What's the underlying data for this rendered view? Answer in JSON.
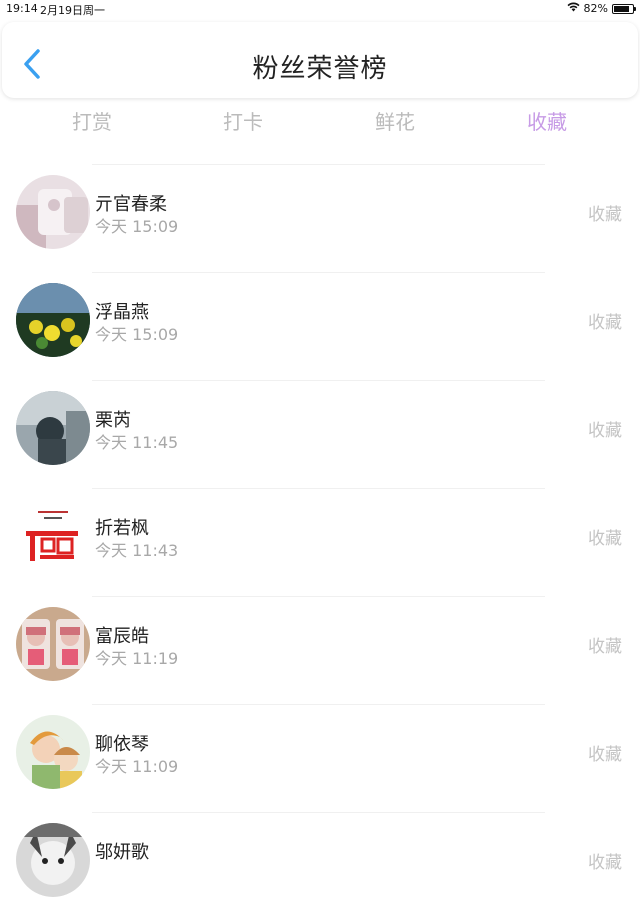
{
  "status_bar": {
    "time": "19:14",
    "date": "2月19日周一",
    "battery": "82%",
    "battery_level": 0.82
  },
  "header": {
    "title": "粉丝荣誉榜",
    "back_icon": "chevron-left-icon",
    "accent_color": "#3aa0f0"
  },
  "tabs": [
    {
      "label": "打赏",
      "active": false
    },
    {
      "label": "打卡",
      "active": false
    },
    {
      "label": "鲜花",
      "active": false
    },
    {
      "label": "收藏",
      "active": true
    }
  ],
  "colors": {
    "active_tab": "#c79be6",
    "inactive_tab": "#bbbbbb",
    "meta_text": "#a8a8a8"
  },
  "fans": [
    {
      "name": "亓官春柔",
      "time": "今天 15:09",
      "action": "收藏"
    },
    {
      "name": "浮晶燕",
      "time": "今天 15:09",
      "action": "收藏"
    },
    {
      "name": "栗芮",
      "time": "今天 11:45",
      "action": "收藏"
    },
    {
      "name": "折若枫",
      "time": "今天 11:43",
      "action": "收藏"
    },
    {
      "name": "富辰皓",
      "time": "今天 11:19",
      "action": "收藏"
    },
    {
      "name": "聊依琴",
      "time": "今天 11:09",
      "action": "收藏"
    },
    {
      "name": "邬妍歌",
      "time": "",
      "action": "收藏"
    }
  ]
}
